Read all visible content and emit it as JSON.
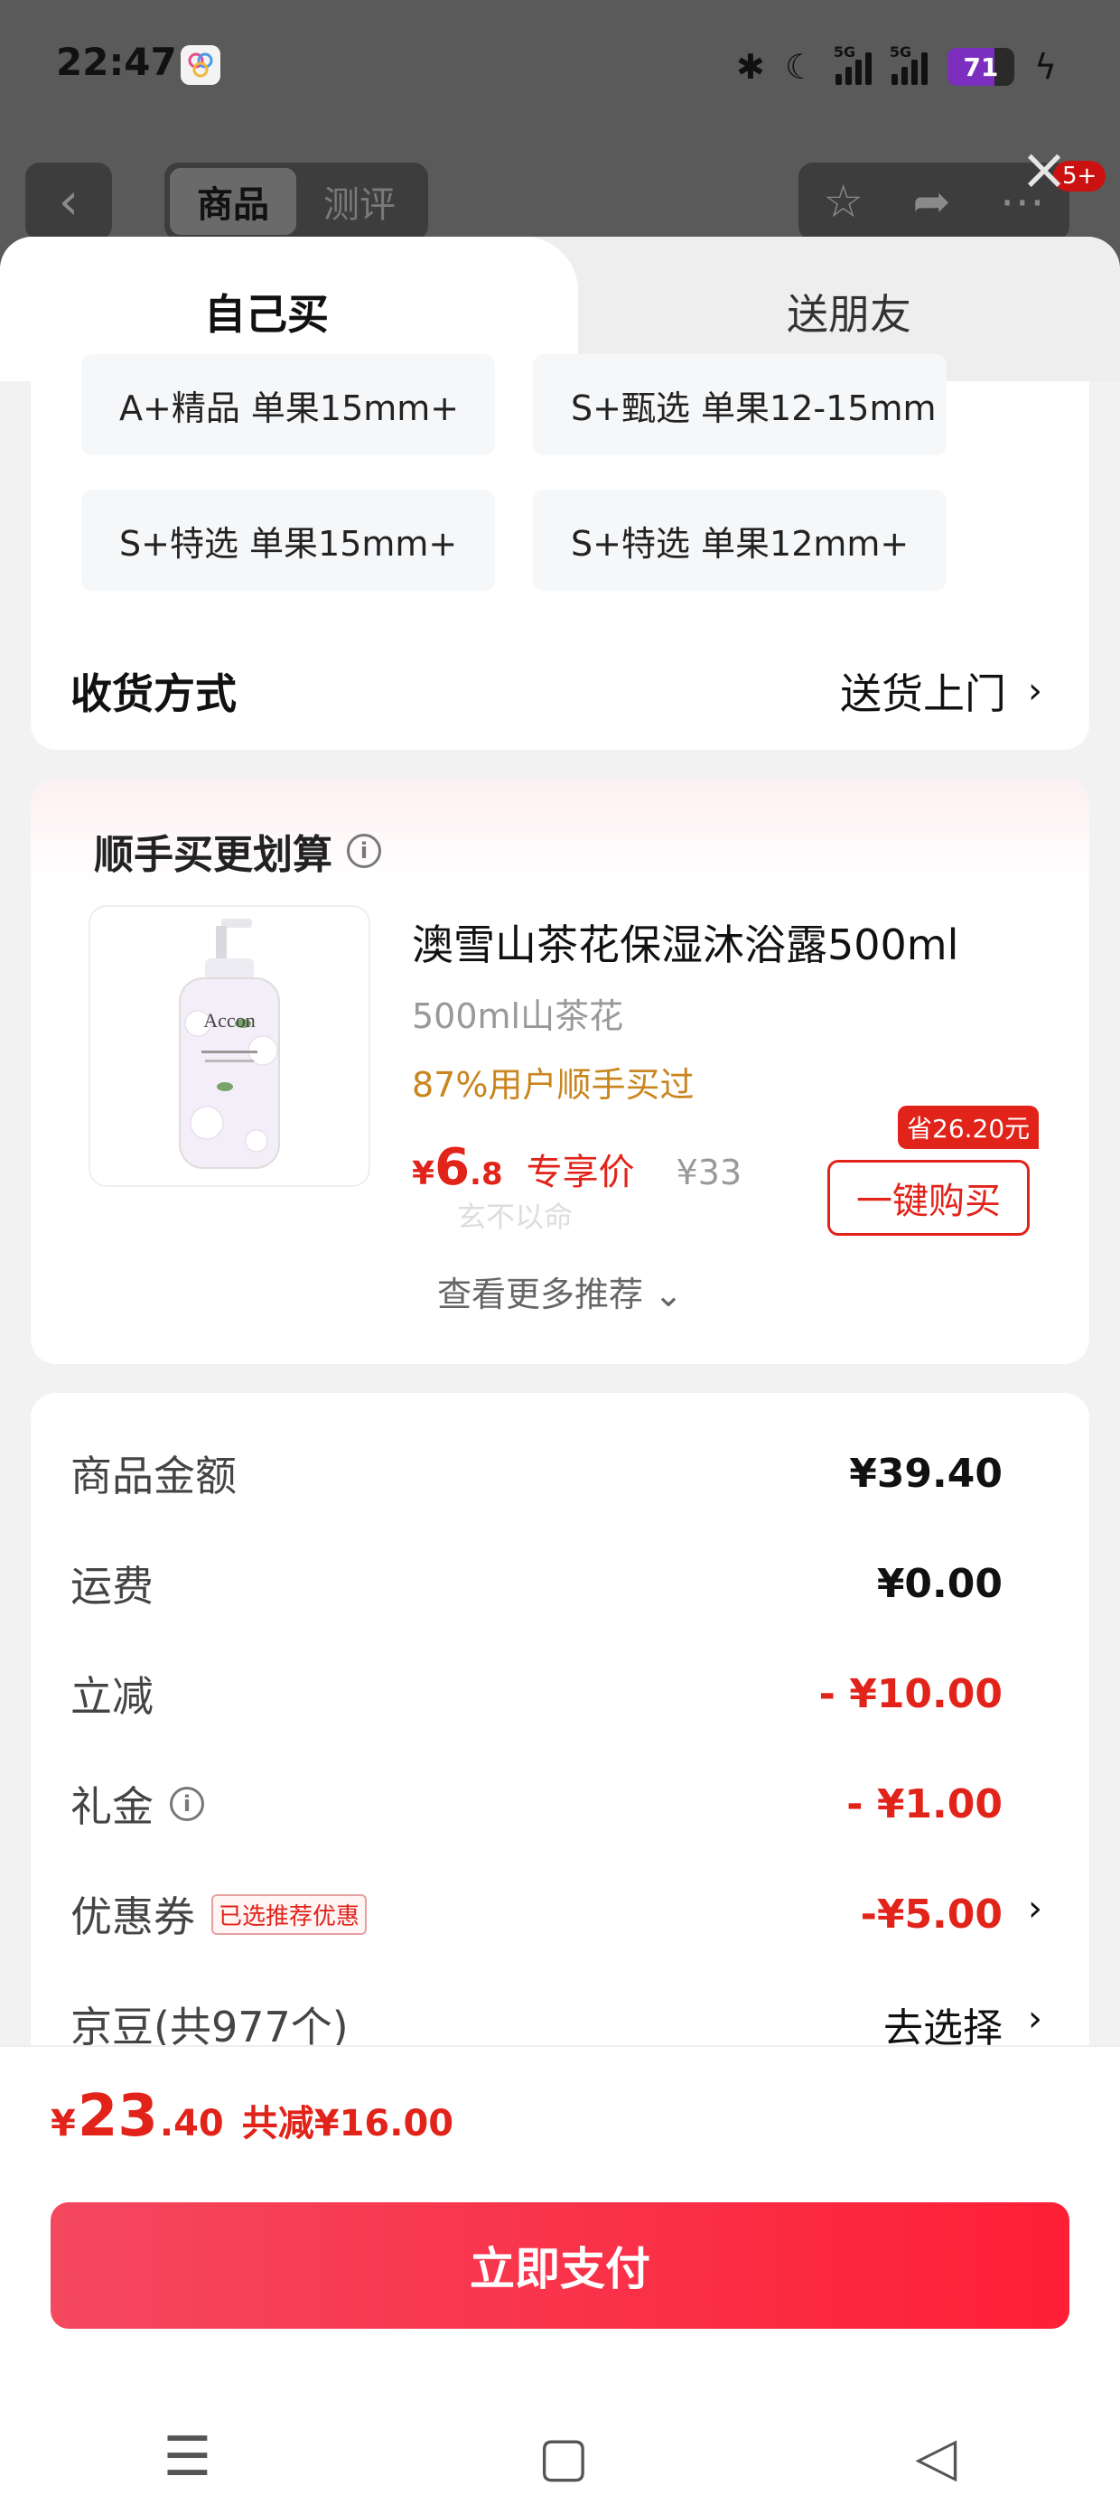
{
  "status_bar": {
    "time": "22:47",
    "battery": "71",
    "icons": [
      "bluetooth-icon",
      "moon-icon",
      "signal-5g-icon",
      "signal-5g-icon",
      "charging-icon"
    ]
  },
  "dim_header": {
    "back": "‹",
    "seg_product": "商品",
    "seg_review": "测评",
    "badge": "5+"
  },
  "sheet": {
    "tab_self": "自己买",
    "tab_friend": "送朋友"
  },
  "spec": {
    "options": [
      "A+精品 单果15mm+",
      "S+甄选 单果12-15mm",
      "S+特选 单果15mm+",
      "S+特选 单果12mm+"
    ],
    "shipping_label": "收货方式",
    "shipping_value": "送货上门"
  },
  "recommend": {
    "title": "顺手买更划算",
    "product_name": "澳雪山茶花保湿沐浴露500ml",
    "product_spec": "500ml山茶花",
    "product_stat": "87%用户顺手买过",
    "price_cur": "¥",
    "price_int": "6",
    "price_dec": ".8",
    "price_label": "专享价",
    "price_orig": "¥33",
    "save_badge": "省26.20元",
    "buy_label": "一键购买",
    "faint_text": "玄不以命",
    "more": "查看更多推荐 ⌄",
    "image_brand": "Accon"
  },
  "summary": {
    "goods_label": "商品金额",
    "goods_value": "¥39.40",
    "freight_label": "运费",
    "freight_value": "¥0.00",
    "discount_label": "立减",
    "discount_value": "- ¥10.00",
    "gift_label": "礼金",
    "gift_value": "- ¥1.00",
    "coupon_label": "优惠券",
    "coupon_tag": "已选推荐优惠",
    "coupon_value": "-¥5.00",
    "jingdou_label": "京豆(共977个)",
    "jingdou_value": "去选择"
  },
  "bottom": {
    "total_cur": "¥",
    "total_int": "23",
    "total_dec": ".40",
    "total_cut": "共减¥16.00",
    "pay_label": "立即支付"
  }
}
